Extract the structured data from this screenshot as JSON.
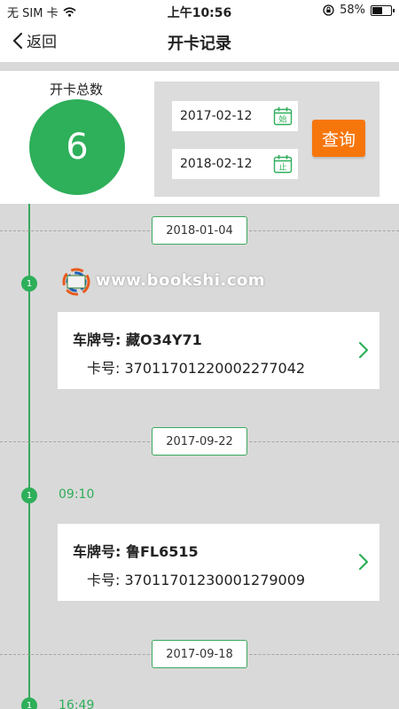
{
  "status_bar": {
    "carrier": "无 SIM 卡",
    "time": "上午10:56",
    "battery": "58%",
    "battery_level": 0.58
  },
  "nav": {
    "back_label": "返回",
    "title": "开卡记录"
  },
  "summary": {
    "total_label": "开卡总数",
    "total_count": "6",
    "start_date": "2017-02-12",
    "start_tag": "始",
    "end_date": "2018-02-12",
    "end_tag": "止",
    "query_label": "查询"
  },
  "timeline": {
    "groups": [
      {
        "date": "2018-01-04",
        "node": "1",
        "time": "",
        "plate_label": "车牌号:",
        "plate": "藏O34Y71",
        "card_label": "卡号:",
        "card_no": "37011701220002277042"
      },
      {
        "date": "2017-09-22",
        "node": "1",
        "time": "09:10",
        "plate_label": "车牌号:",
        "plate": "鲁FL6515",
        "card_label": "卡号:",
        "card_no": "37011701230001279009"
      },
      {
        "date": "2017-09-18",
        "node": "1",
        "time": "16:49"
      }
    ]
  },
  "watermark": {
    "text": "www.bookshi.com"
  },
  "colors": {
    "green": "#2eaf5a",
    "orange": "#f6760c",
    "bg": "#d9d9d9"
  }
}
